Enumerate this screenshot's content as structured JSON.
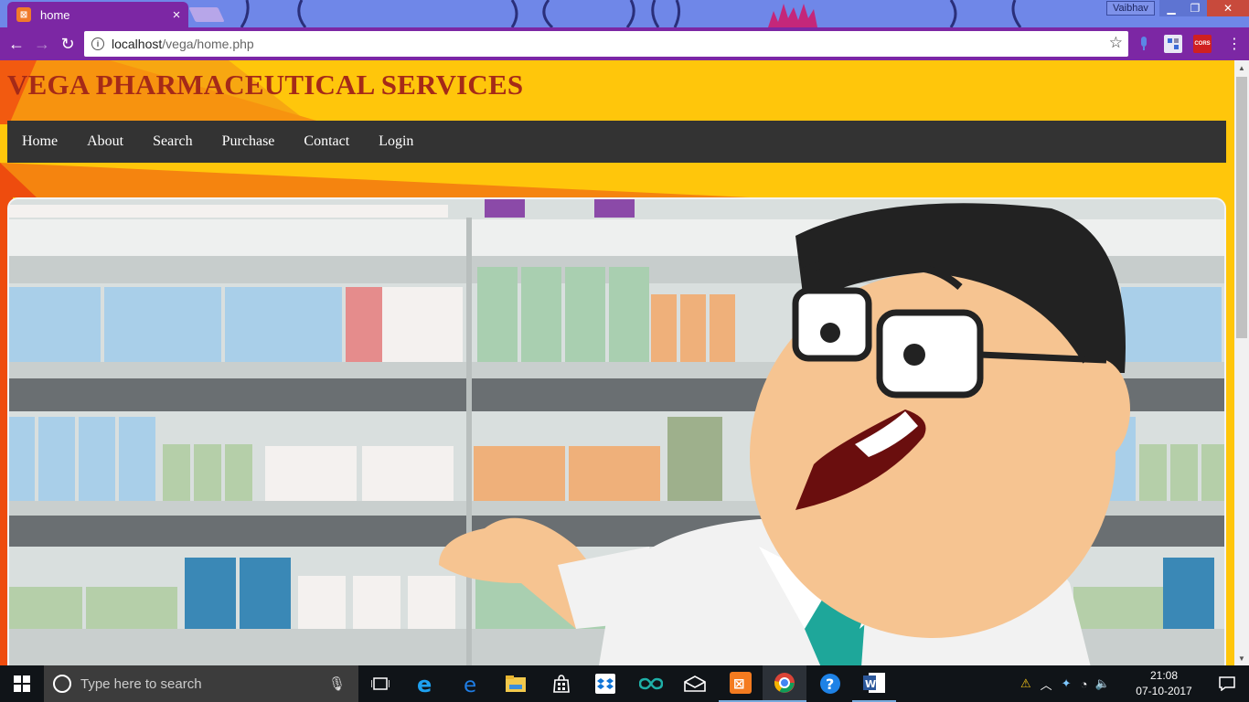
{
  "browser": {
    "tab_title": "home",
    "tab_close": "×",
    "profile_name": "Vaibhav",
    "address_host": "localhost",
    "address_path": "/vega/home.php"
  },
  "site": {
    "title": "VEGA PHARMACEUTICAL SERVICES",
    "nav": [
      "Home",
      "About",
      "Search",
      "Purchase",
      "Contact",
      "Login"
    ]
  },
  "taskbar": {
    "search_placeholder": "Type here to search",
    "clock_time": "21:08",
    "clock_date": "07-10-2017",
    "apps": [
      "task-view",
      "edge-ie",
      "edge",
      "file-explorer",
      "store",
      "dropbox",
      "arduino",
      "mail",
      "xampp",
      "chrome",
      "help",
      "word"
    ]
  },
  "colors": {
    "page_bg": "#ffc60b",
    "accent_orange": "#f47b12",
    "title_color": "#a52a18",
    "nav_bg": "#333333",
    "chrome_purple": "#7c27a4"
  }
}
